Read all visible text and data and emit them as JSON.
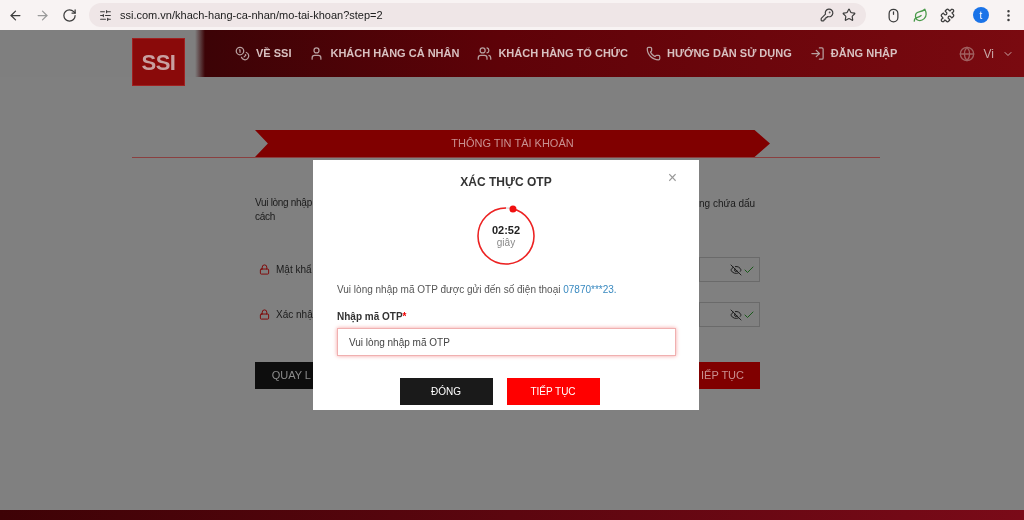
{
  "browser": {
    "url": "ssi.com.vn/khach-hang-ca-nhan/mo-tai-khoan?step=2",
    "profile_initial": "t"
  },
  "header": {
    "logo": "SSI",
    "nav": [
      {
        "label": "VỀ SSI",
        "kind": "coins"
      },
      {
        "label": "KHÁCH HÀNG CÁ NHÂN",
        "kind": "user"
      },
      {
        "label": "KHÁCH HÀNG TỔ CHỨC",
        "kind": "users"
      },
      {
        "label": "HƯỚNG DẪN SỬ DỤNG",
        "kind": "phone"
      },
      {
        "label": "ĐĂNG NHẬP",
        "kind": "login"
      }
    ],
    "language": "Vi"
  },
  "step_banner": "THÔNG TIN TÀI KHOẢN",
  "form": {
    "note_left": [
      "Vui lòng nhập",
      "cách"
    ],
    "note_right": "ng chứa dấu",
    "fields": [
      {
        "label": "Mật khẩ",
        "valid": true
      },
      {
        "label": "Xác nhậ",
        "valid": true
      }
    ],
    "back_button": "QUAY L",
    "next_button": "IẾP TỤC"
  },
  "modal": {
    "title": "XÁC THỰC OTP",
    "close": "×",
    "timer": {
      "time": "02:52",
      "unit": "giây"
    },
    "message": "Vui lòng nhập mã OTP được gửi đến số điện thoại ",
    "phone": "07870***23.",
    "label": "Nhập mã OTP",
    "required_mark": "*",
    "placeholder": "Vui lòng nhập mã OTP",
    "buttons": [
      {
        "label": "ĐÓNG",
        "kind": "secondary"
      },
      {
        "label": "TIẾP TỤC",
        "kind": "primary"
      }
    ]
  }
}
